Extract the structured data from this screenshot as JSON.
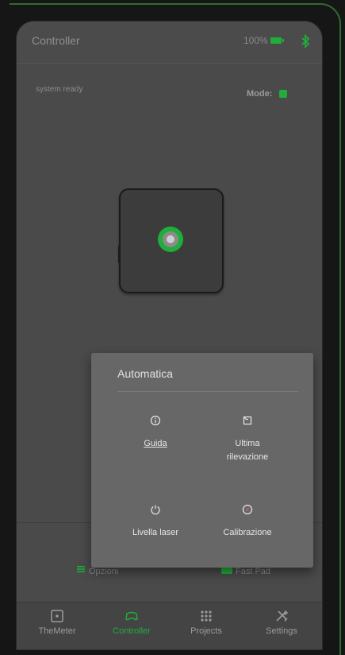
{
  "appbar": {
    "title": "Controller",
    "battery": "100%"
  },
  "status": {
    "text": "system ready",
    "mode_label": "Mode:"
  },
  "bottom": {
    "options_label": "Opzioni",
    "fastpad_label": "Fast Pad"
  },
  "nav": [
    {
      "label": "TheMeter",
      "icon": "square-dot-icon"
    },
    {
      "label": "Controller",
      "icon": "gamepad-icon"
    },
    {
      "label": "Projects",
      "icon": "grid-dots-icon"
    },
    {
      "label": "Settings",
      "icon": "tools-icon"
    }
  ],
  "popup": {
    "title": "Automatica",
    "items": [
      {
        "label": "Guida",
        "icon": "info-icon"
      },
      {
        "label": "Ultima\nrilevazione",
        "icon": "flag-note-icon"
      },
      {
        "label": "Livella laser",
        "icon": "power-icon"
      },
      {
        "label": "Calibrazione",
        "icon": "compass-icon"
      }
    ]
  },
  "colors": {
    "accent": "#1fae3a",
    "surface": "#4a4a4a",
    "popup": "#676767"
  }
}
